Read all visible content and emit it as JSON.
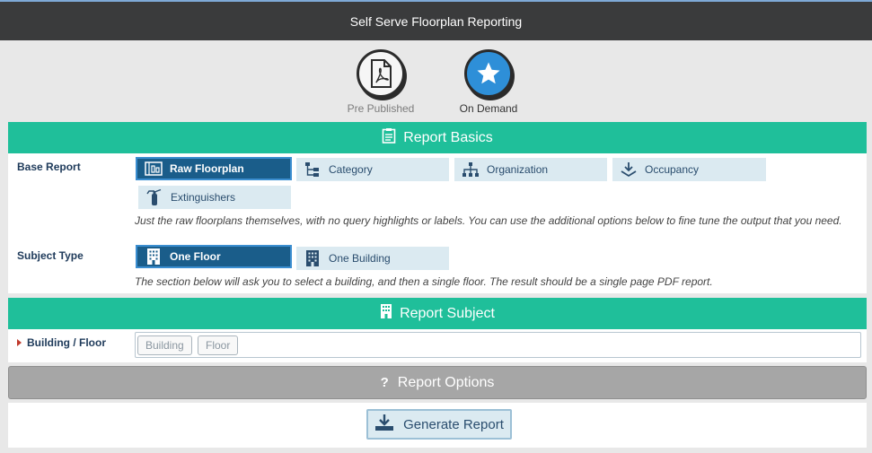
{
  "header": {
    "title": "Self Serve Floorplan Reporting"
  },
  "modes": [
    {
      "label": "Pre Published",
      "icon": "pdf-file-icon"
    },
    {
      "label": "On Demand",
      "icon": "star-icon"
    }
  ],
  "report_basics": {
    "heading": "Report Basics",
    "base_report": {
      "label": "Base Report",
      "options": [
        "Raw Floorplan",
        "Category",
        "Organization",
        "Occupancy",
        "Extinguishers"
      ],
      "selected": "Raw Floorplan",
      "help": "Just the raw floorplans themselves, with no query highlights or labels. You can use the additional options below to fine tune the output that you need."
    },
    "subject_type": {
      "label": "Subject Type",
      "options": [
        "One Floor",
        "One Building"
      ],
      "selected": "One Floor",
      "help": "The section below will ask you to select a building, and then a single floor. The result should be a single page PDF report."
    }
  },
  "report_subject": {
    "heading": "Report Subject",
    "field_label": "Building / Floor",
    "chips": [
      "Building",
      "Floor"
    ]
  },
  "report_options": {
    "heading": "Report Options"
  },
  "actions": {
    "generate_label": "Generate Report"
  },
  "colors": {
    "accent": "#1fbf9a",
    "selected": "#1a5d8a",
    "option_bg": "#dbeaf1",
    "header_bg": "#3a3b3c",
    "mode_blue": "#2e8fd8"
  }
}
